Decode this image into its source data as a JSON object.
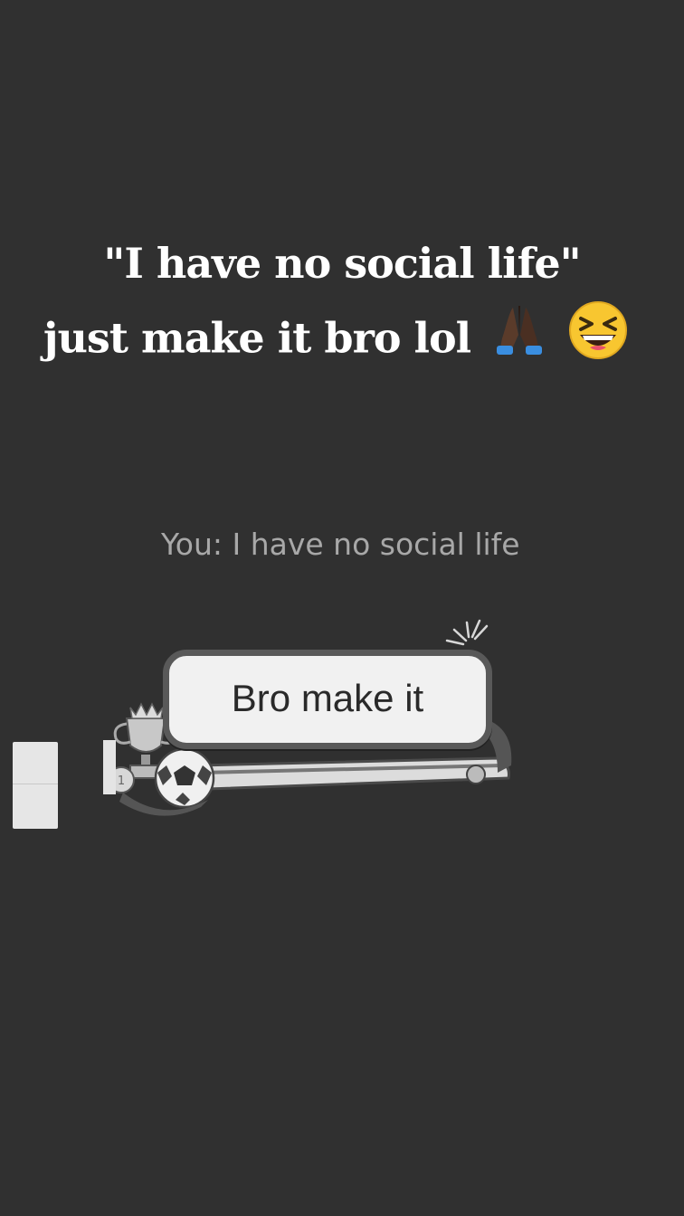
{
  "caption": {
    "line1": "\"I have no social life\"",
    "line2": "just make it bro lol",
    "emoji_1": "praying-hands-emoji",
    "emoji_2": "laughing-squint-emoji"
  },
  "chat": {
    "preview_text": "You: I have no social life",
    "bubble_text": "Bro make it",
    "bubble_decorations": [
      "trophy-icon",
      "soccer-ball-icon",
      "medal-icon",
      "scarf-icon",
      "sparkle-burst-icon"
    ]
  },
  "colors": {
    "background": "#303030",
    "caption_text": "#ffffff",
    "preview_text": "#a8a8a8",
    "bubble_fill": "#f1f1f1",
    "bubble_border": "#595959"
  }
}
